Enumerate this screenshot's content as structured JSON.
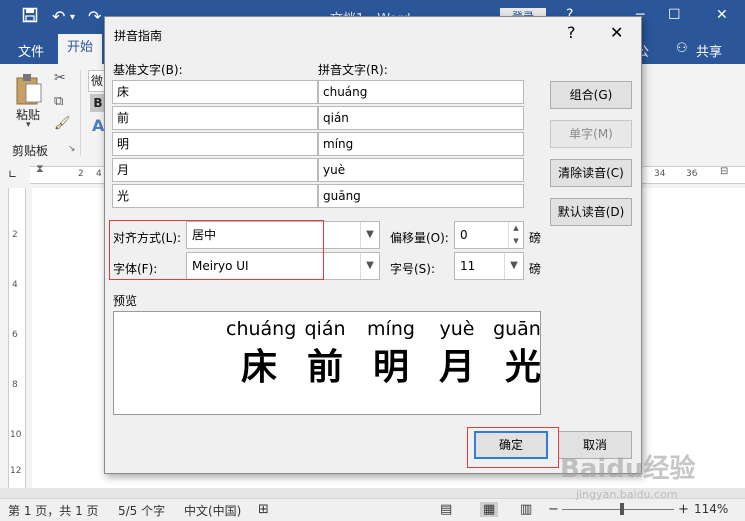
{
  "word": {
    "doc_title": "文档1 - Word",
    "login_label": "登录",
    "help_glyph": "?",
    "tabs": {
      "file": "文件",
      "home": "开始",
      "share": "共享"
    },
    "ribbon": {
      "font_box": "微",
      "paste_label": "粘贴",
      "clipboard_group": "剪贴板",
      "bold": "B"
    },
    "ruler_marks": [
      "2",
      "4",
      "34",
      "36"
    ],
    "left_ruler_marks": [
      "2",
      "4",
      "6",
      "8",
      "10",
      "12"
    ],
    "status": {
      "page": "第 1 页，共 1 页",
      "words": "5/5 个字",
      "language": "中文(中国)",
      "zoom": "114%"
    }
  },
  "dialog": {
    "title": "拼音指南",
    "help_glyph": "?",
    "close_glyph": "✕",
    "base_text_header": "基准文字(B):",
    "ruby_text_header": "拼音文字(R):",
    "rows": [
      {
        "base": "床",
        "ruby": "chuáng"
      },
      {
        "base": "前",
        "ruby": "qián"
      },
      {
        "base": "明",
        "ruby": "míng"
      },
      {
        "base": "月",
        "ruby": "yuè"
      },
      {
        "base": "光",
        "ruby": "guāng"
      }
    ],
    "buttons": {
      "group": "组合(G)",
      "mono": "单字(M)",
      "clear": "清除读音(C)",
      "default_reading": "默认读音(D)",
      "ok": "确定",
      "cancel": "取消"
    },
    "alignment_label": "对齐方式(L):",
    "alignment_value": "居中",
    "offset_label": "偏移量(O):",
    "offset_value": "0",
    "offset_unit": "磅",
    "font_label": "字体(F):",
    "font_value": "Meiryo UI",
    "size_label": "字号(S):",
    "size_value": "11",
    "size_unit": "磅",
    "preview_label": "预览",
    "preview": [
      {
        "ruby": "chuáng",
        "base": "床"
      },
      {
        "ruby": "qián",
        "base": "前"
      },
      {
        "ruby": "míng",
        "base": "明"
      },
      {
        "ruby": "yuè",
        "base": "月"
      },
      {
        "ruby": "guāng",
        "base": "光"
      }
    ]
  },
  "watermark": {
    "main": "Baidu经验",
    "sub": "jingyan.baidu.com"
  }
}
